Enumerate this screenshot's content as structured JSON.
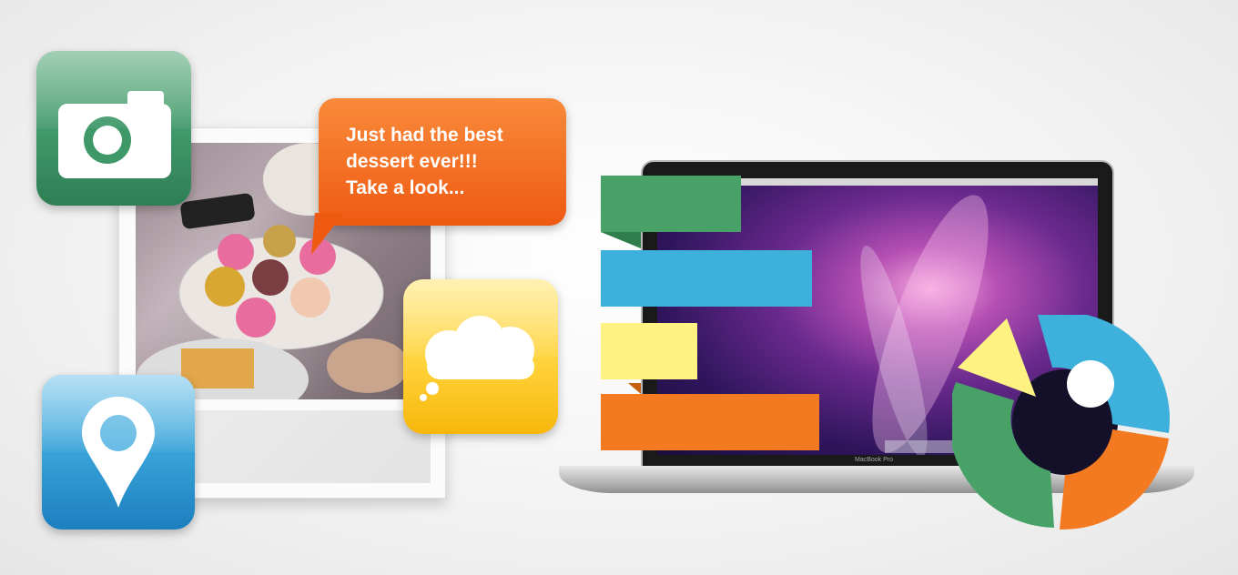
{
  "bubble": {
    "lines": [
      "Just had the best",
      "dessert ever!!!",
      "Take a look..."
    ]
  },
  "laptop": {
    "brand_text": "MacBook Pro"
  },
  "colors": {
    "green": "#48a267",
    "blue": "#3eb0dc",
    "yellow": "#fef282",
    "orange": "#f47a22"
  },
  "icons": {
    "camera_tile": "camera-icon",
    "pin_tile": "map-pin-icon",
    "cloud_tile": "thought-cloud-icon"
  }
}
